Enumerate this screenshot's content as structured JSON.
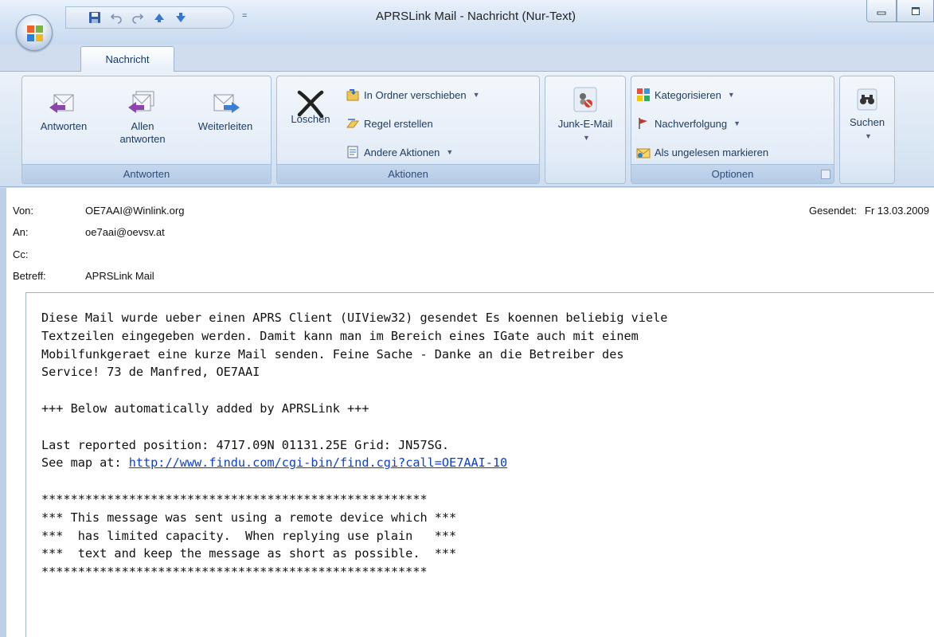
{
  "window": {
    "title": "APRSLink Mail - Nachricht (Nur-Text)",
    "qat_more": "="
  },
  "tabs": [
    {
      "label": "Nachricht",
      "active": true
    }
  ],
  "ribbon": {
    "groups": {
      "respond": {
        "label": "Antworten",
        "reply": "Antworten",
        "reply_all_line1": "Allen",
        "reply_all_line2": "antworten",
        "forward": "Weiterleiten"
      },
      "actions": {
        "label": "Aktionen",
        "delete": "Löschen",
        "move_to_folder": "In Ordner verschieben",
        "create_rule": "Regel erstellen",
        "other_actions": "Andere Aktionen"
      },
      "junk": {
        "label": "Junk-E-Mail"
      },
      "options": {
        "label": "Optionen",
        "categorize": "Kategorisieren",
        "follow_up": "Nachverfolgung",
        "mark_unread": "Als ungelesen markieren"
      },
      "find": {
        "label": "Suchen"
      }
    }
  },
  "header": {
    "from_label": "Von:",
    "from": "OE7AAI@Winlink.org",
    "to_label": "An:",
    "to": "oe7aai@oevsv.at",
    "cc_label": "Cc:",
    "cc": "",
    "subject_label": "Betreff:",
    "subject": "APRSLink Mail",
    "sent_label": "Gesendet:",
    "sent": "Fr 13.03.2009"
  },
  "body": {
    "p1_l1": "Diese Mail wurde ueber einen APRS Client (UIView32) gesendet Es koennen beliebig viele",
    "p1_l2": "Textzeilen eingegeben werden. Damit kann man im Bereich eines IGate auch mit einem",
    "p1_l3": "Mobilfunkgeraet eine kurze Mail senden. Feine Sache - Danke an die Betreiber des",
    "p1_l4": "Service! 73 de Manfred, OE7AAI",
    "added": "+++ Below automatically added by APRSLink +++",
    "position": "Last reported position: 4717.09N 01131.25E Grid: JN57SG.",
    "map_prefix": "See map at: ",
    "map_link": "http://www.findu.com/cgi-bin/find.cgi?call=OE7AAI-10",
    "stars": "*****************************************************",
    "notice1": "*** This message was sent using a remote device which ***",
    "notice2": "***  has limited capacity.  When replying use plain   ***",
    "notice3": "***  text and keep the message as short as possible.  ***"
  },
  "colors": {
    "link": "#0b3fd1",
    "ribbon_bg": "#dbe7f4",
    "group_label": "#2e4d78"
  }
}
